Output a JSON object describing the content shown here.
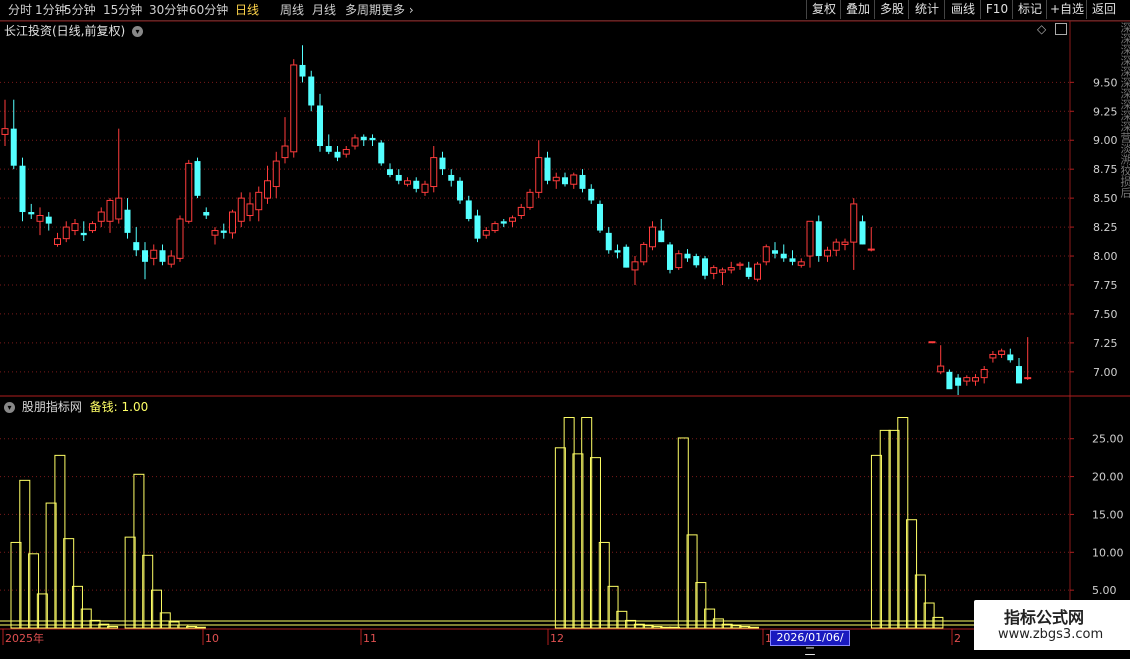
{
  "toolbar": {
    "left": [
      "分时",
      "1分钟",
      "5分钟",
      "15分钟",
      "30分钟",
      "60分钟",
      "日线",
      "周线",
      "月线",
      "多周期",
      "更多"
    ],
    "active": "日线",
    "right": [
      "复权",
      "叠加",
      "多股",
      "统计",
      "画线",
      "F10",
      "标记",
      "+自选",
      "返回"
    ]
  },
  "price_panel": {
    "stock_name": "长江投资(日线,前复权)",
    "y_ticks": [
      "9.50",
      "9.25",
      "9.00",
      "8.75",
      "8.50",
      "8.25",
      "8.00",
      "7.75",
      "7.50",
      "7.25",
      "7.00"
    ]
  },
  "indicator_panel": {
    "name": "股朋指标网",
    "label": "备钱:",
    "value": "1.00",
    "y_ticks": [
      "25.00",
      "20.00",
      "15.00",
      "10.00",
      "5.00"
    ]
  },
  "x_axis": {
    "labels": [
      "2025年",
      "10",
      "11",
      "12",
      "1",
      "2"
    ],
    "selected_date": "2026/01/06/二"
  },
  "watermark": {
    "line1": "指标公式网",
    "line2": "www.zbgs3.com"
  },
  "side_notes": "深深深深深深深深深深营淡溯狡损后",
  "colors": {
    "up": "#ff3c3c",
    "down": "#54ffff",
    "indicator": "#ffff66",
    "grid": "#7a1a1a"
  },
  "chart_data": [
    {
      "type": "candlestick",
      "title": "长江投资(日线,前复权)",
      "ylim": [
        6.8,
        9.9
      ],
      "y_ticks": [
        7.0,
        7.25,
        7.5,
        7.75,
        8.0,
        8.25,
        8.5,
        8.75,
        9.0,
        9.25,
        9.5
      ],
      "candles": [
        [
          9.05,
          9.35,
          8.95,
          9.1
        ],
        [
          9.1,
          9.35,
          8.75,
          8.78
        ],
        [
          8.78,
          8.85,
          8.3,
          8.38
        ],
        [
          8.38,
          8.45,
          8.32,
          8.36
        ],
        [
          8.3,
          8.42,
          8.18,
          8.35
        ],
        [
          8.34,
          8.38,
          8.22,
          8.28
        ],
        [
          8.1,
          8.2,
          8.08,
          8.15
        ],
        [
          8.15,
          8.3,
          8.12,
          8.25
        ],
        [
          8.22,
          8.32,
          8.18,
          8.28
        ],
        [
          8.2,
          8.3,
          8.13,
          8.18
        ],
        [
          8.22,
          8.3,
          8.2,
          8.28
        ],
        [
          8.3,
          8.42,
          8.25,
          8.38
        ],
        [
          8.3,
          8.5,
          8.2,
          8.48
        ],
        [
          8.32,
          9.1,
          8.28,
          8.5
        ],
        [
          8.4,
          8.5,
          8.15,
          8.2
        ],
        [
          8.12,
          8.25,
          8.0,
          8.05
        ],
        [
          8.05,
          8.12,
          7.8,
          7.95
        ],
        [
          7.98,
          8.1,
          7.92,
          8.05
        ],
        [
          8.05,
          8.1,
          7.92,
          7.95
        ],
        [
          7.93,
          8.05,
          7.9,
          8.0
        ],
        [
          7.98,
          8.35,
          7.95,
          8.32
        ],
        [
          8.3,
          8.83,
          8.28,
          8.8
        ],
        [
          8.82,
          8.85,
          8.5,
          8.52
        ],
        [
          8.38,
          8.42,
          8.32,
          8.35
        ],
        [
          8.18,
          8.25,
          8.1,
          8.22
        ],
        [
          8.22,
          8.28,
          8.15,
          8.2
        ],
        [
          8.2,
          8.4,
          8.15,
          8.38
        ],
        [
          8.3,
          8.55,
          8.25,
          8.5
        ],
        [
          8.35,
          8.55,
          8.3,
          8.45
        ],
        [
          8.4,
          8.6,
          8.3,
          8.55
        ],
        [
          8.5,
          8.78,
          8.45,
          8.65
        ],
        [
          8.6,
          8.9,
          8.5,
          8.82
        ],
        [
          8.85,
          9.2,
          8.8,
          8.95
        ],
        [
          8.9,
          9.7,
          8.85,
          9.65
        ],
        [
          9.65,
          9.82,
          9.5,
          9.55
        ],
        [
          9.55,
          9.6,
          9.25,
          9.3
        ],
        [
          9.3,
          9.4,
          8.9,
          8.95
        ],
        [
          8.95,
          9.05,
          8.88,
          8.9
        ],
        [
          8.9,
          8.95,
          8.82,
          8.85
        ],
        [
          8.88,
          8.95,
          8.85,
          8.92
        ],
        [
          8.95,
          9.05,
          8.92,
          9.02
        ],
        [
          9.03,
          9.05,
          8.95,
          9.0
        ],
        [
          9.02,
          9.05,
          8.95,
          9.0
        ],
        [
          8.98,
          9.0,
          8.78,
          8.8
        ],
        [
          8.75,
          8.8,
          8.68,
          8.7
        ],
        [
          8.7,
          8.75,
          8.62,
          8.65
        ],
        [
          8.62,
          8.68,
          8.6,
          8.65
        ],
        [
          8.65,
          8.68,
          8.55,
          8.58
        ],
        [
          8.55,
          8.65,
          8.52,
          8.62
        ],
        [
          8.6,
          8.95,
          8.55,
          8.85
        ],
        [
          8.85,
          8.9,
          8.7,
          8.75
        ],
        [
          8.7,
          8.75,
          8.6,
          8.65
        ],
        [
          8.65,
          8.68,
          8.45,
          8.48
        ],
        [
          8.48,
          8.52,
          8.3,
          8.32
        ],
        [
          8.35,
          8.4,
          8.12,
          8.15
        ],
        [
          8.18,
          8.25,
          8.15,
          8.22
        ],
        [
          8.22,
          8.3,
          8.2,
          8.28
        ],
        [
          8.3,
          8.32,
          8.25,
          8.28
        ],
        [
          8.3,
          8.35,
          8.25,
          8.33
        ],
        [
          8.35,
          8.45,
          8.32,
          8.42
        ],
        [
          8.42,
          8.58,
          8.4,
          8.55
        ],
        [
          8.55,
          9.0,
          8.5,
          8.85
        ],
        [
          8.85,
          8.9,
          8.62,
          8.65
        ],
        [
          8.65,
          8.72,
          8.58,
          8.68
        ],
        [
          8.68,
          8.72,
          8.6,
          8.62
        ],
        [
          8.62,
          8.72,
          8.58,
          8.7
        ],
        [
          8.7,
          8.75,
          8.55,
          8.58
        ],
        [
          8.58,
          8.62,
          8.45,
          8.48
        ],
        [
          8.45,
          8.48,
          8.2,
          8.22
        ],
        [
          8.2,
          8.25,
          8.02,
          8.05
        ],
        [
          8.05,
          8.1,
          7.98,
          8.03
        ],
        [
          8.08,
          8.1,
          7.9,
          7.9
        ],
        [
          7.88,
          8.0,
          7.75,
          7.95
        ],
        [
          7.95,
          8.12,
          7.92,
          8.1
        ],
        [
          8.08,
          8.3,
          8.05,
          8.25
        ],
        [
          8.22,
          8.32,
          8.12,
          8.12
        ],
        [
          8.1,
          8.12,
          7.85,
          7.88
        ],
        [
          7.9,
          8.05,
          7.88,
          8.02
        ],
        [
          8.02,
          8.06,
          7.95,
          7.98
        ],
        [
          8.0,
          8.02,
          7.9,
          7.92
        ],
        [
          7.98,
          8.0,
          7.8,
          7.83
        ],
        [
          7.85,
          7.92,
          7.8,
          7.9
        ],
        [
          7.86,
          7.9,
          7.75,
          7.88
        ],
        [
          7.88,
          7.95,
          7.85,
          7.9
        ],
        [
          7.92,
          7.95,
          7.88,
          7.93
        ],
        [
          7.9,
          7.95,
          7.8,
          7.82
        ],
        [
          7.8,
          7.95,
          7.78,
          7.93
        ],
        [
          7.95,
          8.1,
          7.92,
          8.08
        ],
        [
          8.05,
          8.12,
          7.98,
          8.02
        ],
        [
          8.02,
          8.1,
          7.95,
          7.98
        ],
        [
          7.98,
          8.05,
          7.92,
          7.95
        ],
        [
          7.92,
          7.98,
          7.9,
          7.95
        ],
        [
          8.0,
          8.3,
          7.9,
          8.3
        ],
        [
          8.3,
          8.35,
          7.95,
          8.0
        ],
        [
          8.0,
          8.08,
          7.95,
          8.05
        ],
        [
          8.05,
          8.15,
          8.0,
          8.12
        ],
        [
          8.1,
          8.15,
          8.05,
          8.12
        ],
        [
          8.12,
          8.5,
          7.88,
          8.45
        ],
        [
          8.3,
          8.35,
          8.1,
          8.1
        ],
        [
          8.06,
          8.25,
          8.04,
          8.06
        ]
      ],
      "gap_candles": [
        [
          7.26,
          7.26,
          7.26,
          7.26
        ],
        [
          7.0,
          7.23,
          6.98,
          7.05
        ],
        [
          7.0,
          7.02,
          6.88,
          6.85
        ],
        [
          6.95,
          6.98,
          6.8,
          6.88
        ],
        [
          6.92,
          6.97,
          6.88,
          6.95
        ],
        [
          6.92,
          6.98,
          6.88,
          6.95
        ],
        [
          6.95,
          7.05,
          6.9,
          7.02
        ],
        [
          7.12,
          7.18,
          7.08,
          7.15
        ],
        [
          7.15,
          7.2,
          7.12,
          7.18
        ],
        [
          7.15,
          7.2,
          7.08,
          7.1
        ],
        [
          7.05,
          7.12,
          6.92,
          6.9
        ],
        [
          6.95,
          7.3,
          6.93,
          6.95
        ]
      ]
    },
    {
      "type": "bar",
      "title": "股朋指标网",
      "ylim": [
        0,
        28
      ],
      "y_ticks": [
        5,
        10,
        15,
        20,
        25
      ],
      "series": [
        {
          "name": "备钱",
          "values": [
            11.3,
            19.5,
            9.8,
            4.5,
            16.5,
            22.8,
            11.8,
            5.5,
            2.5,
            1.0,
            0.5,
            0.2,
            0,
            12.0,
            20.3,
            9.6,
            5.0,
            2.0,
            0.8,
            0.4,
            0.2,
            0.1,
            0,
            0,
            0,
            0,
            0,
            0,
            0,
            0,
            0,
            0,
            0,
            0,
            0,
            0,
            0,
            0,
            0,
            0,
            0,
            0,
            0,
            0,
            0,
            0,
            0,
            0,
            0,
            0,
            0,
            0,
            0,
            0,
            0,
            0,
            0,
            0,
            0,
            0,
            0,
            0,
            23.8,
            27.8,
            23.0,
            27.8,
            22.5,
            11.3,
            5.5,
            2.2,
            1.0,
            0.5,
            0.3,
            0.2,
            0.1,
            0.1,
            25.1,
            12.3,
            6.0,
            2.5,
            1.2,
            0.5,
            0.3,
            0.2,
            0.1,
            0,
            0,
            0,
            0,
            0,
            0,
            0,
            0,
            0,
            0,
            0,
            0,
            0,
            22.8,
            26.1,
            26.1,
            27.8,
            14.3,
            7.0,
            3.3,
            1.4
          ]
        }
      ]
    }
  ]
}
